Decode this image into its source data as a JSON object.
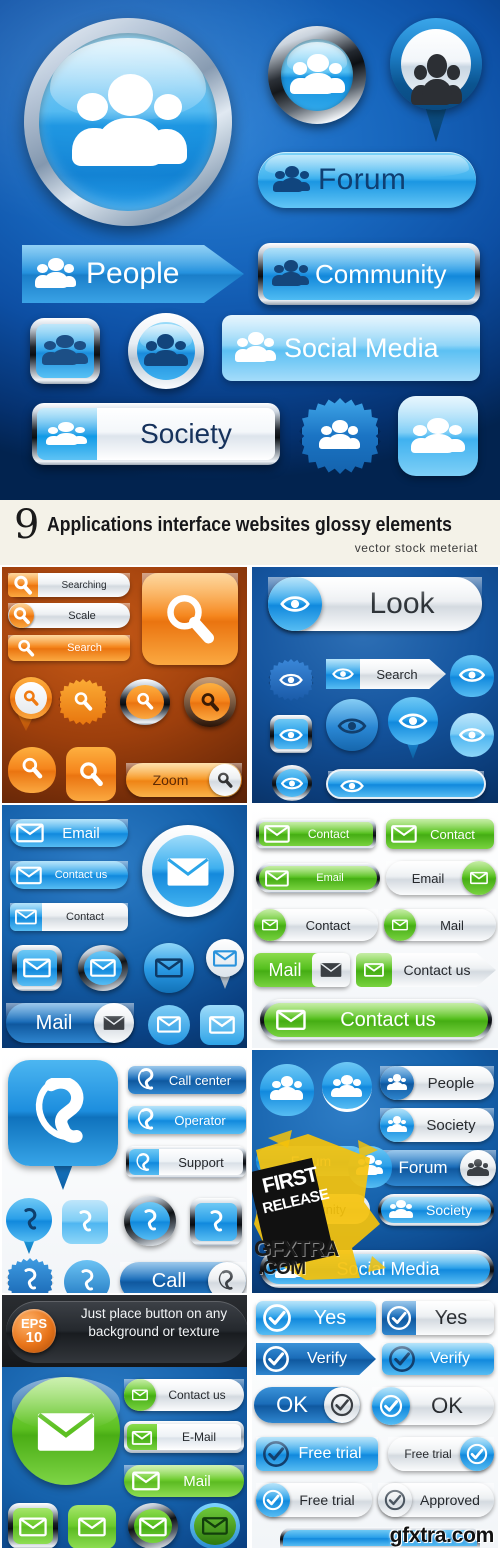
{
  "banner": {
    "title_number": "9",
    "title": "Applications interface websites glossy elements",
    "subtitle": "vector stock meteriat",
    "hero_items": [
      {
        "name": "big-round-people-button",
        "label": ""
      },
      {
        "name": "metal-ring-people-button",
        "label": ""
      },
      {
        "name": "people-map-pin",
        "label": ""
      },
      {
        "name": "forum-pill-button",
        "label": "Forum"
      },
      {
        "name": "people-arrow-button",
        "label": "People"
      },
      {
        "name": "community-metal-button",
        "label": "Community"
      },
      {
        "name": "people-square-metal-icon",
        "label": ""
      },
      {
        "name": "people-ring-circle-icon",
        "label": ""
      },
      {
        "name": "social-media-button",
        "label": "Social Media"
      },
      {
        "name": "society-split-button",
        "label": "Society"
      },
      {
        "name": "people-starburst-icon",
        "label": ""
      },
      {
        "name": "people-rounded-square-icon",
        "label": ""
      }
    ]
  },
  "panels": [
    {
      "id": "search-orange",
      "theme": "orange",
      "icon": "magnifier-icon",
      "buttons": [
        {
          "label": "Searching",
          "style": "gray-pill-left-icon"
        },
        {
          "label": "Scale",
          "style": "gray-pill-round-icon"
        },
        {
          "label": "Search",
          "style": "orange-rect"
        },
        {
          "label": "Zoom",
          "style": "orange-pill-right-icon"
        }
      ],
      "icons": [
        "square-large",
        "pin",
        "starburst",
        "metal-ring",
        "dark-ring",
        "balloon",
        "rounded-square"
      ]
    },
    {
      "id": "eye-blue",
      "theme": "blue",
      "icon": "eye-icon",
      "buttons": [
        {
          "label": "Look",
          "style": "gray-pill-left-icon"
        },
        {
          "label": "Search",
          "style": "gray-chevron"
        }
      ],
      "icons": [
        "round-gloss",
        "starburst",
        "pin",
        "square-metal",
        "circle-dark",
        "pill-empty"
      ]
    },
    {
      "id": "email-blue",
      "theme": "blue",
      "icon": "envelope-icon",
      "buttons": [
        {
          "label": "Email",
          "style": "blue-pill"
        },
        {
          "label": "Contact us",
          "style": "blue-pill"
        },
        {
          "label": "Contact",
          "style": "gray-rect-blue-icon"
        },
        {
          "label": "Mail",
          "style": "blue-pill-right-gray-icon"
        }
      ],
      "icons": [
        "big-ring-circle",
        "square-metal",
        "metal-ring",
        "round-gloss",
        "pin",
        "rounded-square"
      ]
    },
    {
      "id": "contact-green",
      "theme": "green",
      "icon": "envelope-icon",
      "buttons": [
        {
          "label": "Contact",
          "style": "green-rect-metal"
        },
        {
          "label": "Contact",
          "style": "green-rect"
        },
        {
          "label": "Email",
          "style": "green-pill-metal"
        },
        {
          "label": "Email",
          "style": "gray-pill-right-green-icon"
        },
        {
          "label": "Contact",
          "style": "gray-pill-left-green-icon"
        },
        {
          "label": "Mail",
          "style": "gray-pill-left-green-icon"
        },
        {
          "label": "Mail",
          "style": "green-rect-gray-icon"
        },
        {
          "label": "Contact us",
          "style": "gray-chevron-green-icon"
        },
        {
          "label": "Contact us",
          "style": "green-pill-wide"
        }
      ]
    },
    {
      "id": "phone-blue",
      "theme": "blue",
      "icon": "phone-icon",
      "buttons": [
        {
          "label": "Call center",
          "style": "blue-rect"
        },
        {
          "label": "Operator",
          "style": "blue-rect-light"
        },
        {
          "label": "Support",
          "style": "gray-metal-split"
        },
        {
          "label": "Call",
          "style": "blue-pill-right-gray-icon"
        }
      ],
      "icons": [
        "big-pin",
        "pin-small",
        "rounded-square",
        "metal-ring",
        "square-metal",
        "starburst",
        "round-gloss"
      ]
    },
    {
      "id": "people-blue",
      "theme": "blue",
      "icon": "people-icon",
      "buttons": [
        {
          "label": "People",
          "style": "gray-pill-left-blue-icon"
        },
        {
          "label": "Society",
          "style": "gray-pill-left-blue-icon"
        },
        {
          "label": "Forum",
          "style": "blue-pill-right-gray-icon"
        },
        {
          "label": "Society",
          "style": "blue-pill-metal"
        },
        {
          "label": "Social Media",
          "style": "blue-pill-metal-wide"
        },
        {
          "label": "Forum",
          "style": "obscured"
        },
        {
          "label": "Community",
          "style": "obscured"
        }
      ],
      "watermark": {
        "line1": "FIRST",
        "line2": "RELEASE",
        "site1": "GFXTRA",
        "site2": ".COM"
      }
    },
    {
      "id": "eps-note",
      "theme": "dark",
      "badge_line1": "EPS",
      "badge_line2": "10",
      "text_line1": "Just place button on any",
      "text_line2": "background or texture"
    },
    {
      "id": "mail-green",
      "theme": "blue",
      "icon": "envelope-icon",
      "buttons": [
        {
          "label": "Contact us",
          "style": "gray-pill-left-green-icon"
        },
        {
          "label": "E-Mail",
          "style": "gray-metal-split-green"
        },
        {
          "label": "Mail",
          "style": "green-pill"
        }
      ],
      "icons": [
        "big-green-circle",
        "square-metal",
        "rounded-square",
        "metal-ring",
        "round-gloss"
      ]
    },
    {
      "id": "confirm-blue",
      "theme": "blue",
      "icon": "check-circle-icon",
      "buttons": [
        {
          "label": "Yes",
          "style": "blue-rect"
        },
        {
          "label": "Yes",
          "style": "gray-rect-blue-icon"
        },
        {
          "label": "Verify",
          "style": "blue-chevron"
        },
        {
          "label": "Verify",
          "style": "blue-pill-gloss"
        },
        {
          "label": "OK",
          "style": "darkblue-pill-right-gray-icon"
        },
        {
          "label": "OK",
          "style": "gray-pill-left-blue-icon"
        },
        {
          "label": "Free trial",
          "style": "blue-rect"
        },
        {
          "label": "Free trial",
          "style": "gray-pill-right-blue-icon"
        },
        {
          "label": "Free trial",
          "style": "gray-pill-left-blue-icon"
        },
        {
          "label": "Approved",
          "style": "gray-pill-left-blue-icon"
        }
      ]
    }
  ],
  "watermark_bottom": "gfxtra.com"
}
